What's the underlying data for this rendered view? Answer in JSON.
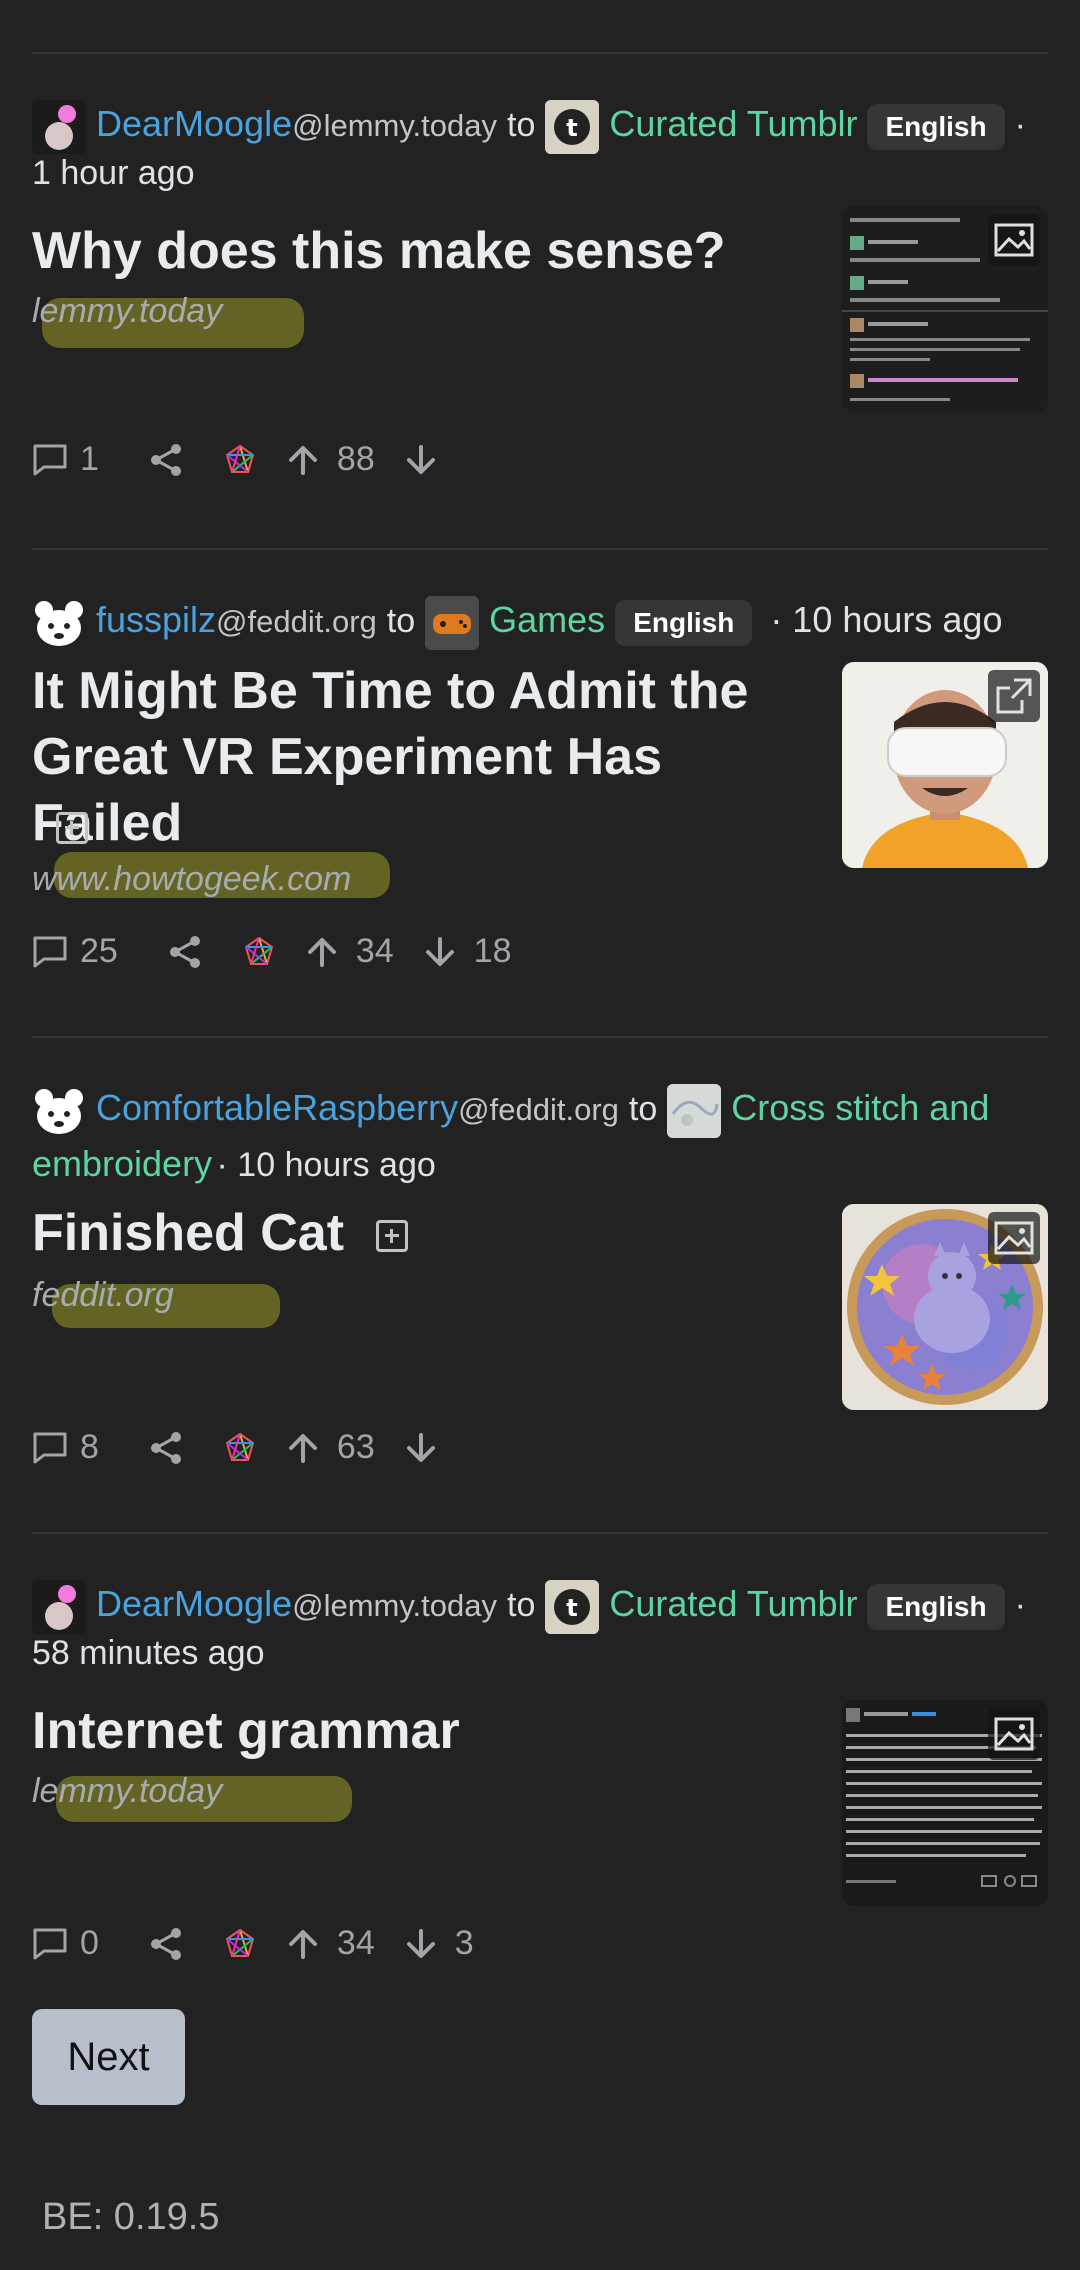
{
  "posts": [
    {
      "user": "DearMoogle",
      "instance": "@lemmy.today",
      "to": "to",
      "community": "Curated Tumblr",
      "language": "English",
      "time": "1 hour ago",
      "title": "Why does this make sense?",
      "domain": "lemmy.today",
      "comments": "1",
      "upvotes": "88",
      "downvotes": ""
    },
    {
      "user": "fusspilz",
      "instance": "@feddit.org",
      "to": "to",
      "community": "Games",
      "language": "English",
      "time": "· 10 hours ago",
      "title_line1": "It Might Be Time to Admit the",
      "title_line2": "Great VR Experiment Has Failed",
      "domain": "www.howtogeek.com",
      "comments": "25",
      "upvotes": "34",
      "downvotes": "18"
    },
    {
      "user": "ComfortableRaspberry",
      "instance": "@feddit.org",
      "to": "to",
      "community_line1": "Cross stitch and",
      "community_line2": "embroidery",
      "time": "· 10 hours ago",
      "title": "Finished Cat",
      "domain": "feddit.org",
      "comments": "8",
      "upvotes": "63",
      "downvotes": ""
    },
    {
      "user": "DearMoogle",
      "instance": "@lemmy.today",
      "to": "to",
      "community": "Curated Tumblr",
      "language": "English",
      "time": "58 minutes ago",
      "title": "Internet grammar",
      "domain": "lemmy.today",
      "comments": "0",
      "upvotes": "34",
      "downvotes": "3"
    }
  ],
  "pagination": {
    "next_label": "Next"
  },
  "footer": {
    "version": "BE: 0.19.5"
  },
  "colors": {
    "background": "#222222",
    "user": "#4aa3df",
    "community": "#5fd4a0",
    "next_button": "#b7c0ca"
  },
  "icons": [
    "comment-icon",
    "share-icon",
    "fediverse-icon",
    "upvote-icon",
    "downvote-icon",
    "image-icon",
    "external-link-icon",
    "expand-icon"
  ]
}
